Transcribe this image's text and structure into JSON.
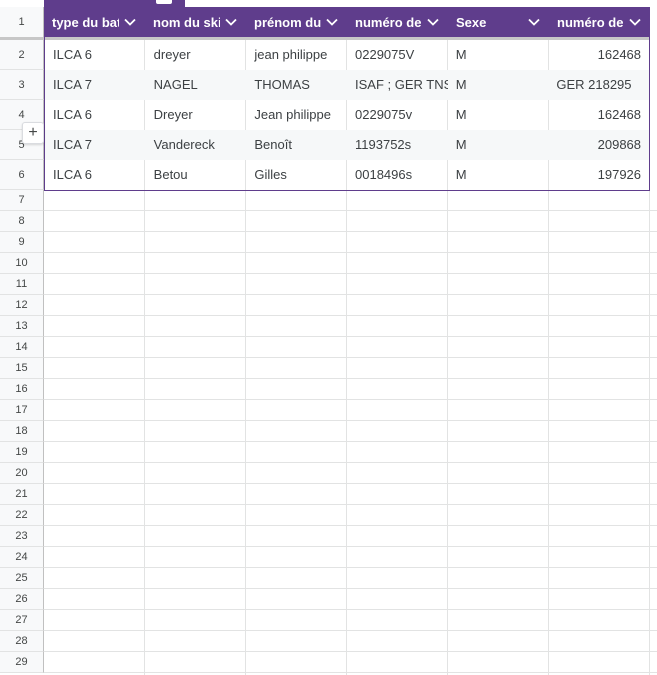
{
  "colors": {
    "header_bg": "#5f3d8c",
    "header_text": "#ffffff",
    "alt_row": "#f6f8f9"
  },
  "table": {
    "headers": [
      "type du bat",
      "nom du ski",
      "prénom du",
      "numéro de",
      "Sexe",
      "numéro de"
    ],
    "rows": [
      [
        "ILCA 6",
        "dreyer",
        "jean philippe",
        "0229075V",
        "M",
        "162468"
      ],
      [
        "ILCA 7",
        "NAGEL",
        "THOMAS",
        "ISAF ; GER TNS",
        "M",
        "GER 218295"
      ],
      [
        "ILCA 6",
        "Dreyer",
        "Jean philippe",
        "0229075v",
        "M",
        "162468"
      ],
      [
        "ILCA 7",
        "Vandereck",
        "Benoît",
        "1193752s",
        "M",
        "209868"
      ],
      [
        "ILCA 6",
        "Betou",
        "Gilles",
        "0018496s",
        "M",
        "197926"
      ]
    ]
  },
  "row_numbers": [
    "1",
    "2",
    "3",
    "4",
    "5",
    "6",
    "7",
    "8",
    "9",
    "10",
    "11",
    "12",
    "13",
    "14",
    "15",
    "16",
    "17",
    "18",
    "19",
    "20",
    "21",
    "22",
    "23",
    "24",
    "25",
    "26",
    "27",
    "28",
    "29"
  ],
  "add_button_icon": "plus-icon",
  "add_button_label": "+",
  "header_dropdown_icon": "chevron-down-icon"
}
